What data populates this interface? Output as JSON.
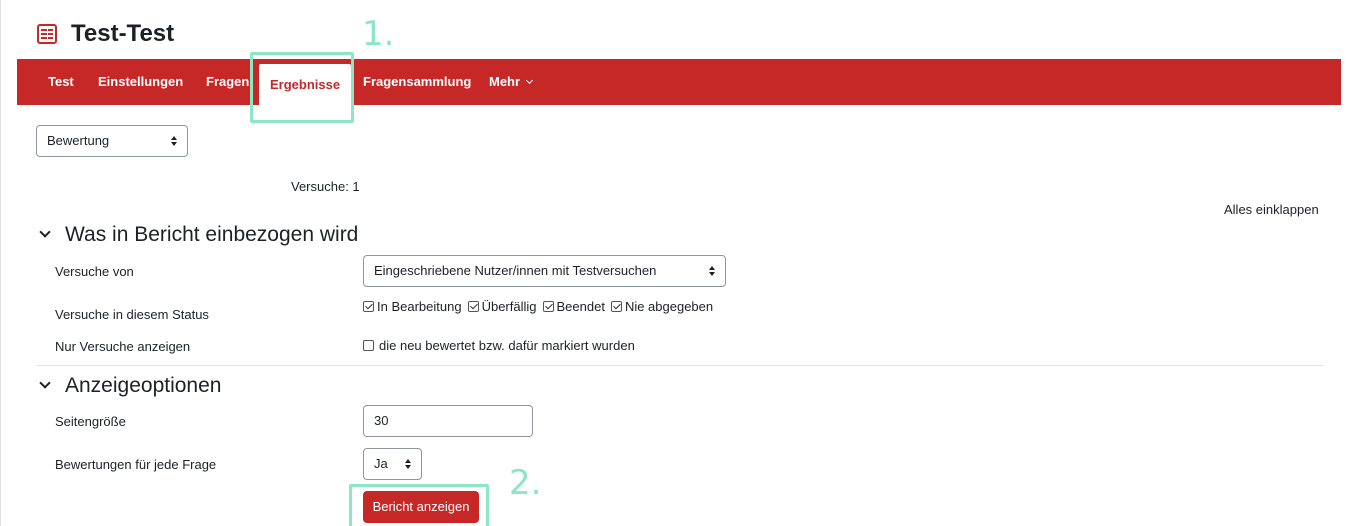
{
  "header": {
    "title": "Test-Test",
    "icon": "quiz-icon"
  },
  "nav": {
    "items": [
      {
        "label": "Test"
      },
      {
        "label": "Einstellungen"
      },
      {
        "label": "Fragen"
      },
      {
        "label": "Ergebnisse"
      },
      {
        "label": "Fragensammlung"
      },
      {
        "label": "Mehr"
      }
    ],
    "active": "Ergebnisse"
  },
  "report_select": {
    "value": "Bewertung"
  },
  "attempts_summary": "Versuche: 1",
  "collapse_all": "Alles einklappen",
  "section1": {
    "title": "Was in Bericht einbezogen wird",
    "attempts_from": {
      "label": "Versuche von",
      "value": "Eingeschriebene Nutzer/innen mit Testversuchen"
    },
    "status": {
      "label": "Versuche in diesem Status",
      "options": [
        {
          "label": "In Bearbeitung",
          "checked": true
        },
        {
          "label": "Überfällig",
          "checked": true
        },
        {
          "label": "Beendet",
          "checked": true
        },
        {
          "label": "Nie abgegeben",
          "checked": true
        }
      ]
    },
    "only_show": {
      "label": "Nur Versuche anzeigen",
      "option": "die neu bewertet bzw. dafür markiert wurden",
      "checked": false
    }
  },
  "section2": {
    "title": "Anzeigeoptionen",
    "page_size": {
      "label": "Seitengröße",
      "value": "30"
    },
    "marks_per_question": {
      "label": "Bewertungen für jede Frage",
      "value": "Ja"
    },
    "submit_label": "Bericht anzeigen"
  },
  "annotations": {
    "first": "1.",
    "second": "2."
  },
  "colors": {
    "brand": "#c62828",
    "annotation": "#8de6c6"
  }
}
